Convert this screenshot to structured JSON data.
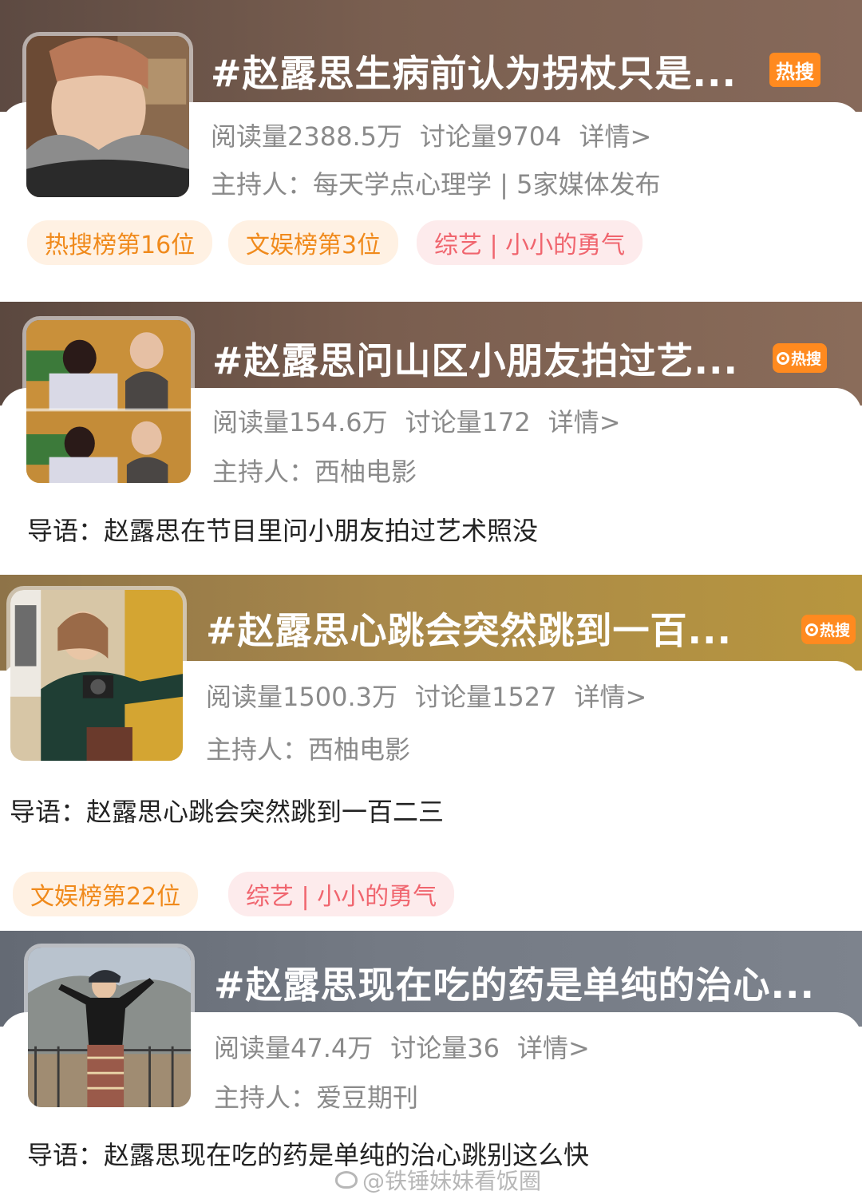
{
  "cards": [
    {
      "title": "#赵露思生病前认为拐杖只是...",
      "badge": "热搜",
      "reads": "阅读量2388.5万",
      "discussions": "讨论量9704",
      "details": "详情>",
      "host": "主持人：每天学点心理学 | 5家媒体发布",
      "tags": [
        "热搜榜第16位",
        "文娱榜第3位",
        "综艺 | 小小的勇气"
      ]
    },
    {
      "title": "#赵露思问山区小朋友拍过艺...",
      "badge": "热搜",
      "reads": "阅读量154.6万",
      "discussions": "讨论量172",
      "details": "详情>",
      "host": "主持人：西柚电影",
      "lead": "导语：赵露思在节目里问小朋友拍过艺术照没"
    },
    {
      "title": "#赵露思心跳会突然跳到一百...",
      "badge": "热搜",
      "reads": "阅读量1500.3万",
      "discussions": "讨论量1527",
      "details": "详情>",
      "host": "主持人：西柚电影",
      "lead": "导语：赵露思心跳会突然跳到一百二三",
      "tags": [
        "文娱榜第22位",
        "综艺 | 小小的勇气"
      ]
    },
    {
      "title": "#赵露思现在吃的药是单纯的治心...",
      "reads": "阅读量47.4万",
      "discussions": "讨论量36",
      "details": "详情>",
      "host": "主持人：爱豆期刊",
      "lead": "导语：赵露思现在吃的药是单纯的治心跳别这么快"
    }
  ],
  "watermark": "@铁锤妹妹看饭圈",
  "colors": {
    "band1": "#6e5549",
    "band2": "#6f5547",
    "band3": "#a3844a",
    "band4": "#6e7480",
    "badge": "#ff8a1f",
    "tag_orange_text": "#f08a1c",
    "tag_red_text": "#f0656e"
  },
  "icons": [
    "hot-badge-icon",
    "weibo-logo-icon"
  ]
}
